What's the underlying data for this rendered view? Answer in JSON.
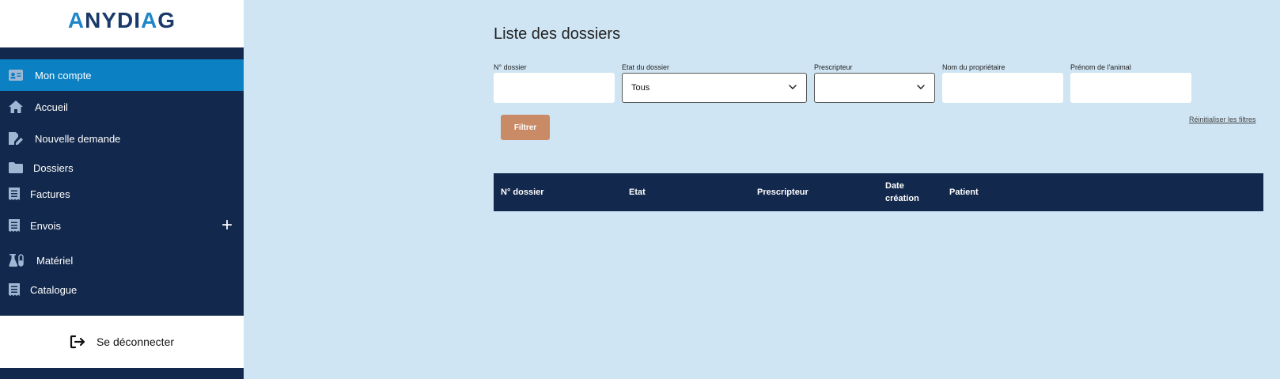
{
  "brand": {
    "logo_text_1": "A",
    "logo_text_2": "NYDI",
    "logo_text_3": "A",
    "logo_text_4": "G"
  },
  "sidebar": {
    "items": [
      {
        "label": "Mon compte",
        "icon": "id-card-icon",
        "active": true
      },
      {
        "label": "Accueil",
        "icon": "home-icon"
      },
      {
        "label": "Nouvelle demande",
        "icon": "edit-document-icon"
      },
      {
        "label": "Dossiers",
        "icon": "folder-icon"
      },
      {
        "label": "Factures",
        "icon": "receipt-icon"
      },
      {
        "label": "Envois",
        "icon": "receipt-icon",
        "expand": "+"
      },
      {
        "label": "Matériel",
        "icon": "flask-icon"
      },
      {
        "label": "Catalogue",
        "icon": "receipt-icon"
      }
    ],
    "logout_label": "Se déconnecter"
  },
  "main": {
    "title": "Liste des dossiers",
    "filters": {
      "dossier_label": "N° dossier",
      "dossier_value": "",
      "etat_label": "Etat du dossier",
      "etat_value": "Tous",
      "prescripteur_label": "Prescripteur",
      "prescripteur_value": "",
      "proprietaire_label": "Nom du propriétaire",
      "proprietaire_value": "",
      "animal_label": "Prénom de l'animal",
      "animal_value": ""
    },
    "filter_button": "Filtrer",
    "reset_link": "Réinitialiser les filtres",
    "table": {
      "columns": [
        "N° dossier",
        "Etat",
        "Prescripteur",
        "Date création",
        "Patient"
      ],
      "col_date_line1": "Date",
      "col_date_line2": "création",
      "rows": []
    }
  },
  "colors": {
    "sidebar_bg": "#12284c",
    "active_bg": "#0b80c2",
    "main_bg": "#cfe5f3",
    "filter_button": "#c98a66"
  }
}
